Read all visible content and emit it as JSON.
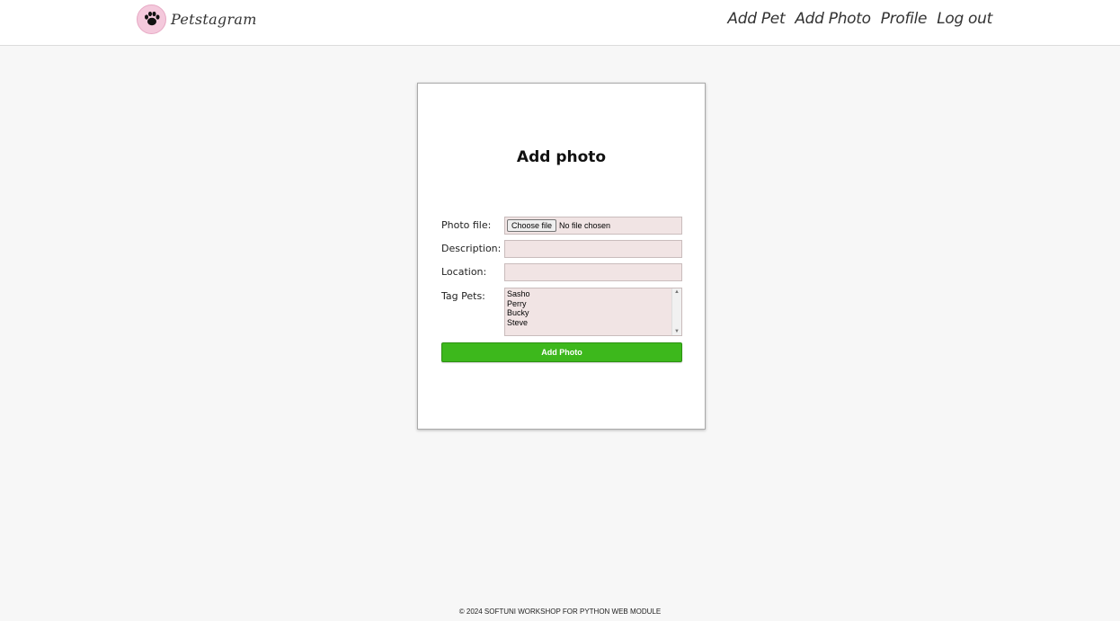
{
  "header": {
    "logo_text": "Petstagram",
    "nav": [
      {
        "label": "Add Pet"
      },
      {
        "label": "Add Photo"
      },
      {
        "label": "Profile"
      },
      {
        "label": "Log out"
      }
    ]
  },
  "form": {
    "title": "Add photo",
    "photo_label": "Photo file:",
    "choose_file_label": "Choose file",
    "file_status": "No file chosen",
    "description_label": "Description:",
    "description_value": "",
    "location_label": "Location:",
    "location_value": "",
    "tag_label": "Tag Pets:",
    "pets": [
      "Sasho",
      "Perry",
      "Bucky",
      "Steve"
    ],
    "submit_label": "Add Photo"
  },
  "footer": {
    "text": "© 2024 SOFTUNI WORKSHOP FOR PYTHON WEB MODULE"
  },
  "colors": {
    "submit_bg": "#3db81c",
    "field_bg": "#f1e4e4",
    "logo_pink": "#f4c9dc"
  },
  "icons": {
    "logo": "paw-print-icon",
    "scroll_up": "scroll-up-arrow-icon",
    "scroll_down": "scroll-down-arrow-icon"
  }
}
